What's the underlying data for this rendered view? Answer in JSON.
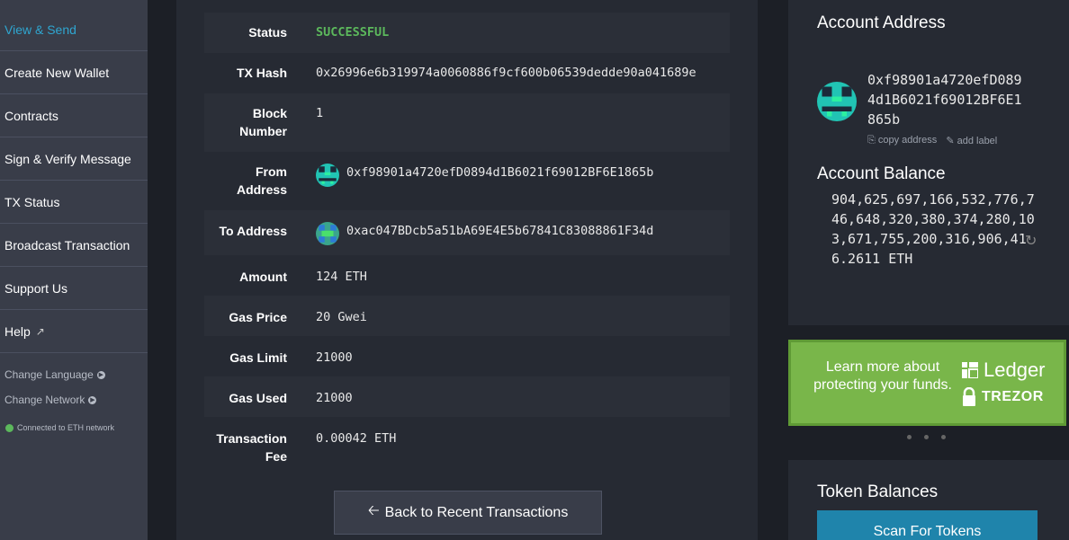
{
  "sidebar": {
    "items": [
      {
        "label": "View & Send",
        "active": true
      },
      {
        "label": "Create New Wallet"
      },
      {
        "label": "Contracts"
      },
      {
        "label": "Sign & Verify Message"
      },
      {
        "label": "TX Status"
      },
      {
        "label": "Broadcast Transaction"
      },
      {
        "label": "Support Us"
      },
      {
        "label": "Help"
      }
    ],
    "change_language": "Change Language",
    "change_network": "Change Network",
    "network_status": "Connected to ETH network"
  },
  "tx": {
    "status_label": "Status",
    "status_value": "SUCCESSFUL",
    "hash_label": "TX Hash",
    "hash_value": "0x26996e6b319974a0060886f9cf600b06539dedde90a041689e",
    "block_label": "Block Number",
    "block_value": "1",
    "from_label": "From Address",
    "from_value": "0xf98901a4720efD0894d1B6021f69012BF6E1865b",
    "to_label": "To Address",
    "to_value": "0xac047BDcb5a51bA69E4E5b67841C83088861F34d",
    "amount_label": "Amount",
    "amount_value": "124 ETH",
    "gas_price_label": "Gas Price",
    "gas_price_value": "20 Gwei",
    "gas_limit_label": "Gas Limit",
    "gas_limit_value": "21000",
    "gas_used_label": "Gas Used",
    "gas_used_value": "21000",
    "fee_label": "Transaction Fee",
    "fee_value": "0.00042 ETH",
    "back_button": "Back to Recent Transactions"
  },
  "account": {
    "address_heading": "Account Address",
    "address": "0xf98901a4720efD0894d1B6021f69012BF6E1865b",
    "copy_label": "copy address",
    "add_label": "add label",
    "balance_heading": "Account Balance",
    "balance": "904,625,697,166,532,776,746,648,320,380,374,280,103,671,755,200,316,906,416.2611 ETH"
  },
  "promo": {
    "text": "Learn more about protecting your funds.",
    "ledger": "Ledger",
    "trezor": "TREZOR"
  },
  "tokens": {
    "heading": "Token Balances",
    "scan_button": "Scan For Tokens"
  },
  "colors": {
    "accent": "#2fa6d0",
    "success": "#5cb85c",
    "promo_green": "#79b64a",
    "scan_blue": "#1f84ab"
  }
}
